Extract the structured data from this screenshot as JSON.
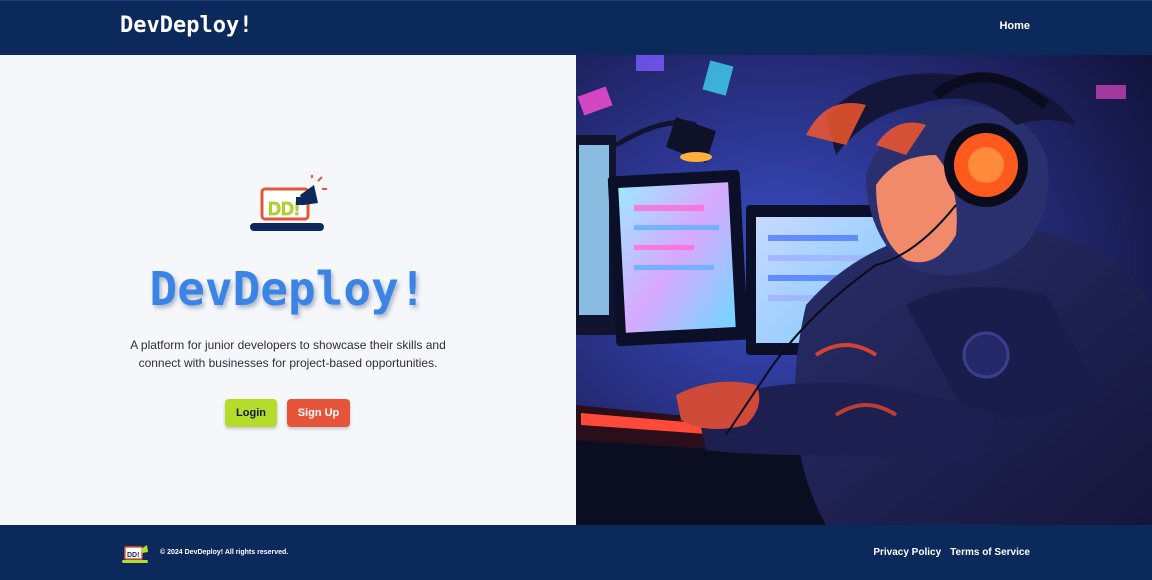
{
  "header": {
    "brand": "DevDeploy!",
    "nav": {
      "home_label": "Home"
    }
  },
  "hero": {
    "logo_text": "DD!",
    "title": "DevDeploy!",
    "description": "A platform for junior developers to showcase their skills and connect with businesses for project-based opportunities.",
    "buttons": {
      "login_label": "Login",
      "signup_label": "Sign Up"
    },
    "image_icon": "developer-illustration"
  },
  "footer": {
    "logo_text": "DD!",
    "copyright": "© 2024 DevDeploy! All rights reserved.",
    "links": {
      "privacy": "Privacy Policy",
      "terms": "Terms of Service"
    }
  },
  "colors": {
    "navy": "#0b2a5b",
    "title_blue": "#3b84e6",
    "login_green": "#b5dc2b",
    "signup_red": "#e6553a",
    "hero_bg": "#f5f7fb"
  }
}
